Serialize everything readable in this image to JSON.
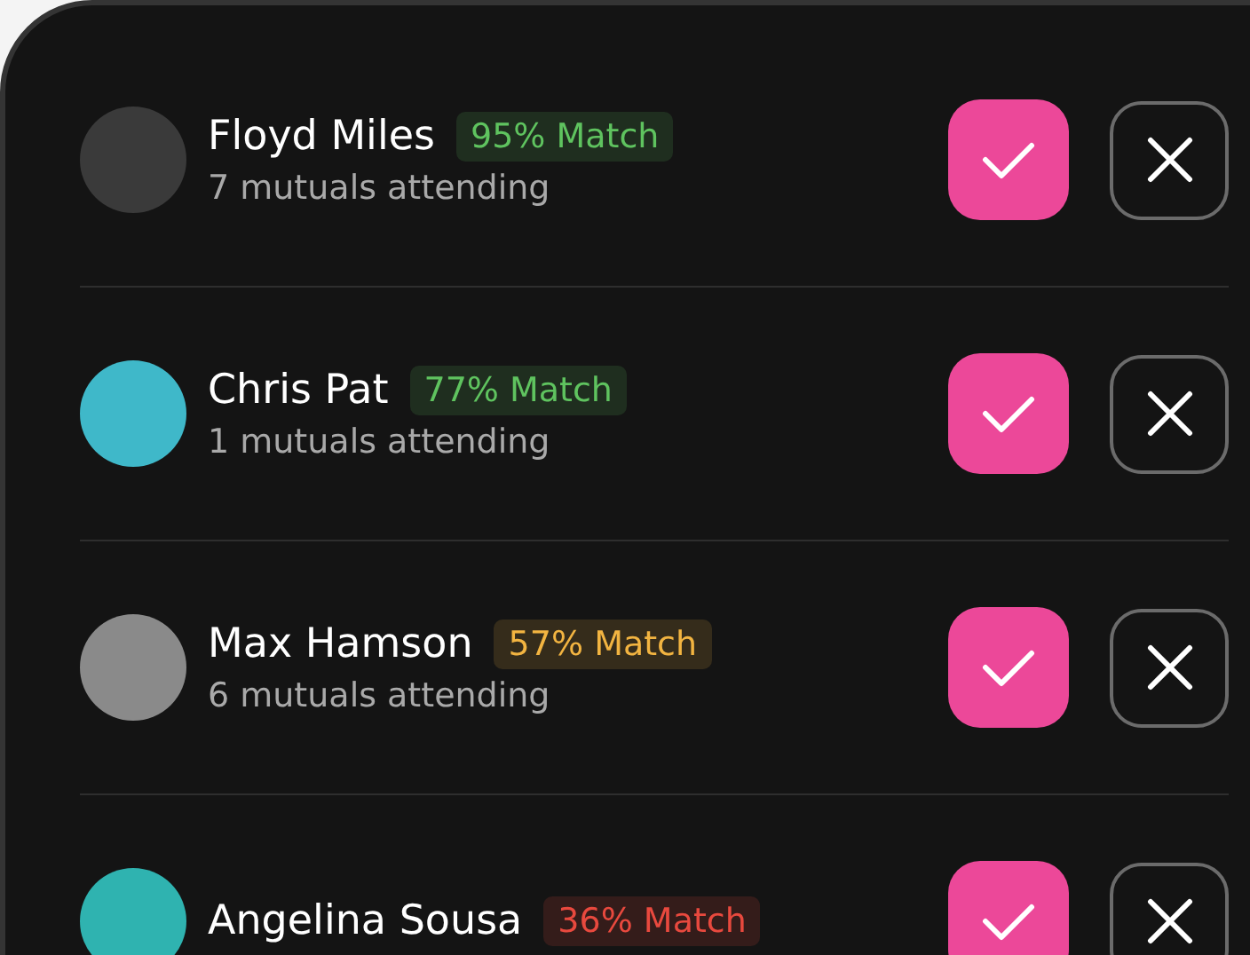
{
  "people": [
    {
      "name": "Floyd Miles",
      "match": "95% Match",
      "color": "#5fc35f",
      "mutuals": "7 mutuals attending"
    },
    {
      "name": "Chris Pat",
      "match": "77% Match",
      "color": "#5fc35f",
      "mutuals": "1 mutuals attending"
    },
    {
      "name": "Max Hamson",
      "match": "57% Match",
      "color": "#f2b441",
      "mutuals": "6 mutuals attending"
    },
    {
      "name": "Angelina Sousa",
      "match": "36% Match",
      "color": "#e8493e"
    }
  ]
}
